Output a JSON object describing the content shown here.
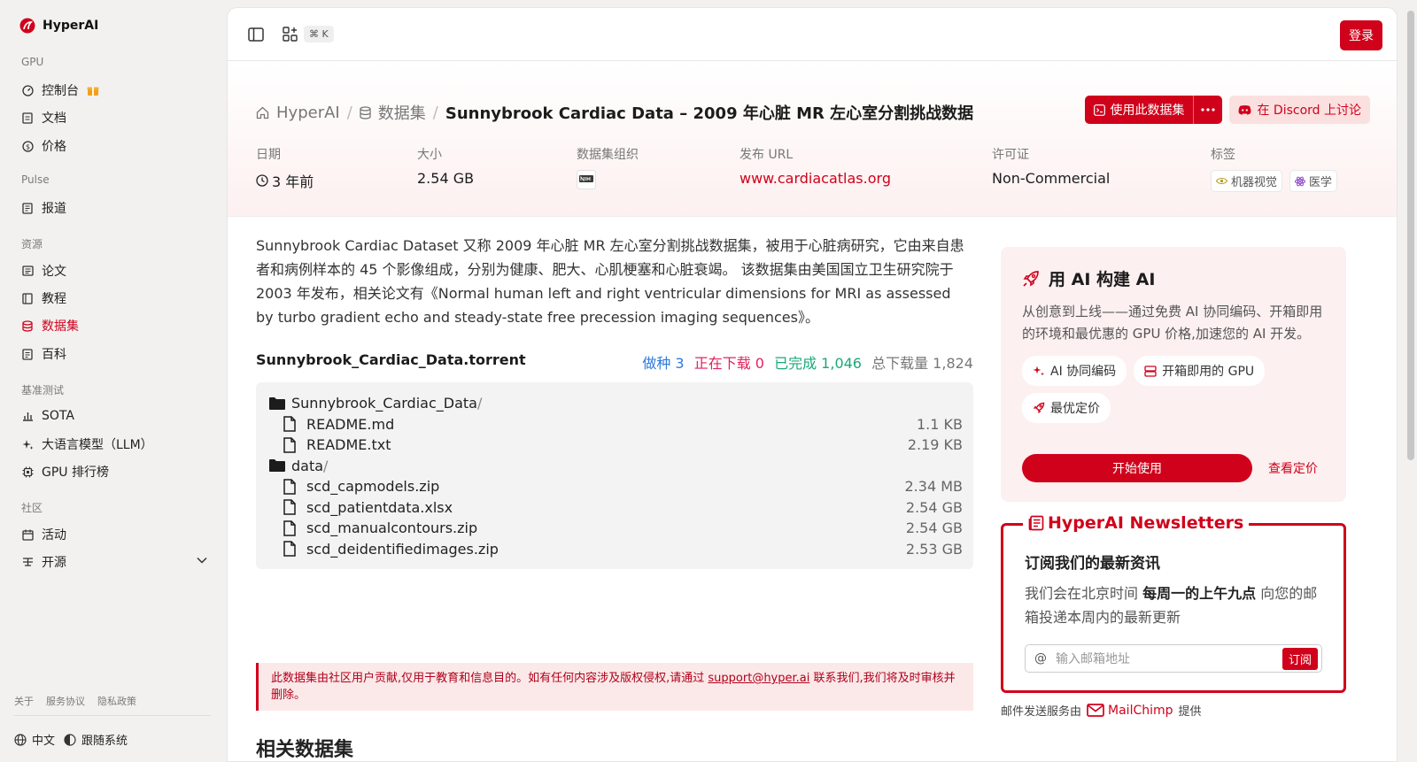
{
  "brand": {
    "name": "HyperAI"
  },
  "sidebar": {
    "sections": [
      {
        "label": "GPU",
        "items": [
          {
            "label": "控制台",
            "icon": "dashboard-icon"
          },
          {
            "label": "文档",
            "icon": "doc-icon"
          },
          {
            "label": "价格",
            "icon": "dollar-icon"
          }
        ]
      },
      {
        "label": "Pulse",
        "items": [
          {
            "label": "报道",
            "icon": "news-icon"
          }
        ]
      },
      {
        "label": "资源",
        "items": [
          {
            "label": "论文",
            "icon": "paper-icon"
          },
          {
            "label": "教程",
            "icon": "book-icon"
          },
          {
            "label": "数据集",
            "icon": "database-icon"
          },
          {
            "label": "百科",
            "icon": "wiki-icon"
          }
        ]
      },
      {
        "label": "基准测试",
        "items": [
          {
            "label": "SOTA",
            "icon": "chart-icon"
          },
          {
            "label": "大语言模型（LLM）",
            "icon": "sparkle-icon"
          },
          {
            "label": "GPU 排行榜",
            "icon": "chip-icon"
          }
        ]
      },
      {
        "label": "社区",
        "items": [
          {
            "label": "活动",
            "icon": "calendar-icon"
          },
          {
            "label": "开源",
            "icon": "list-icon"
          }
        ]
      }
    ],
    "active": "数据集",
    "footer_links": [
      "关于",
      "服务协议",
      "隐私政策"
    ],
    "language": "中文",
    "theme": "跟随系统"
  },
  "topbar": {
    "shortcut": "⌘ K",
    "login_label": "登录"
  },
  "breadcrumb": {
    "home": "HyperAI",
    "section": "数据集",
    "current": "Sunnybrook Cardiac Data – 2009 年心脏 MR 左心室分割挑战数据"
  },
  "actions": {
    "use_dataset": "使用此数据集",
    "discord": "在 Discord 上讨论"
  },
  "meta": {
    "date_label": "日期",
    "date_value": "3 年前",
    "size_label": "大小",
    "size_value": "2.54 GB",
    "org_label": "数据集组织",
    "url_label": "发布 URL",
    "url_value": "www.cardiacatlas.org",
    "license_label": "许可证",
    "license_value": "Non-Commercial",
    "tags_label": "标签",
    "tags": [
      "机器视觉",
      "医学"
    ]
  },
  "description": "Sunnybrook Cardiac Dataset 又称 2009 年心脏 MR 左心室分割挑战数据集，被用于心脏病研究，它由来自患者和病例样本的 45 个影像组成，分别为健康、肥大、心肌梗塞和心脏衰竭。 该数据集由美国国立卫生研究院于 2003 年发布，相关论文有《Normal human left and right ventricular dimensions for MRI as assessed by turbo gradient echo and steady-state free precession imaging sequences》。",
  "torrent": {
    "name": "Sunnybrook_Cardiac_Data.torrent",
    "seeding": "做种 3",
    "downloading": "正在下载 0",
    "completed": "已完成 1,046",
    "total": "总下载量 1,824",
    "colors": {
      "seeding": "#2f7bdc",
      "downloading": "#e0245e",
      "completed": "#1aa87a"
    }
  },
  "files": [
    {
      "name": "Sunnybrook_Cardiac_Data",
      "type": "folder",
      "size": ""
    },
    {
      "name": "README.md",
      "type": "file",
      "size": "1.1 KB"
    },
    {
      "name": "README.txt",
      "type": "file",
      "size": "2.19 KB"
    },
    {
      "name": "data",
      "type": "folder",
      "size": ""
    },
    {
      "name": "scd_capmodels.zip",
      "type": "file",
      "size": "2.34 MB"
    },
    {
      "name": "scd_patientdata.xlsx",
      "type": "file",
      "size": "2.54 GB"
    },
    {
      "name": "scd_manualcontours.zip",
      "type": "file",
      "size": "2.54 GB"
    },
    {
      "name": "scd_deidentifiedimages.zip",
      "type": "file",
      "size": "2.53 GB"
    }
  ],
  "notice": {
    "before": "此数据集由社区用户贡献,仅用于教育和信息目的。如有任何内容涉及版权侵权,请通过 ",
    "email": "support@hyper.ai",
    "after": " 联系我们,我们将及时审核并删除。"
  },
  "related_title": "相关数据集",
  "ai_card": {
    "title": "用 AI 构建 AI",
    "subtitle": "从创意到上线——通过免费 AI 协同编码、开箱即用的环境和最优惠的 GPU 价格,加速您的 AI 开发。",
    "chips": [
      "AI 协同编码",
      "开箱即用的 GPU",
      "最优定价"
    ],
    "start": "开始使用",
    "pricing": "查看定价"
  },
  "newsletter": {
    "title": "HyperAI Newsletters",
    "heading": "订阅我们的最新资讯",
    "text_before": "我们会在北京时间 ",
    "text_bold": "每周一的上午九点",
    "text_after": " 向您的邮箱投递本周内的最新更新",
    "placeholder": "输入邮箱地址",
    "subscribe": "订阅"
  },
  "mailchimp": {
    "before": "邮件发送服务由",
    "brand": "MailChimp",
    "after": "提供"
  },
  "accent": "#d0021b"
}
